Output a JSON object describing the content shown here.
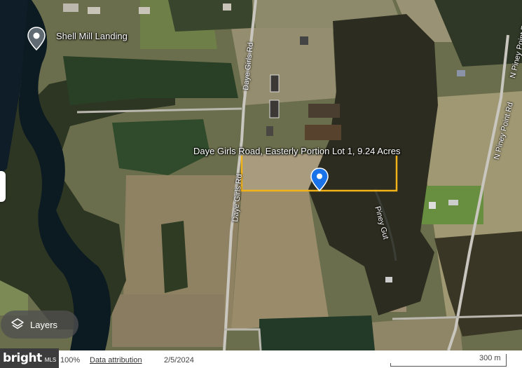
{
  "map": {
    "place_label": "Shell Mill Landing",
    "parcel_label": "Daye Girls Road, Easterly Portion Lot 1, 9.24 Acres",
    "roads": {
      "daye_girls_north": "Daye Girls Rd",
      "daye_girls_south": "Daye Girls Rd",
      "piney_point_north": "N Piney Point Rd",
      "piney_point_south": "N Piney Point Rd"
    },
    "water_label": "Piney Gut",
    "colors": {
      "parcel_outline": "#f2b21a",
      "pin": "#1a73e8",
      "water": "#0c1a22"
    }
  },
  "controls": {
    "layers_label": "Layers"
  },
  "footer": {
    "brand": "bright",
    "brand_sub": "MLS",
    "zoom": "100%",
    "attribution": "Data attribution",
    "date": "2/5/2024",
    "scale": "300 m"
  }
}
